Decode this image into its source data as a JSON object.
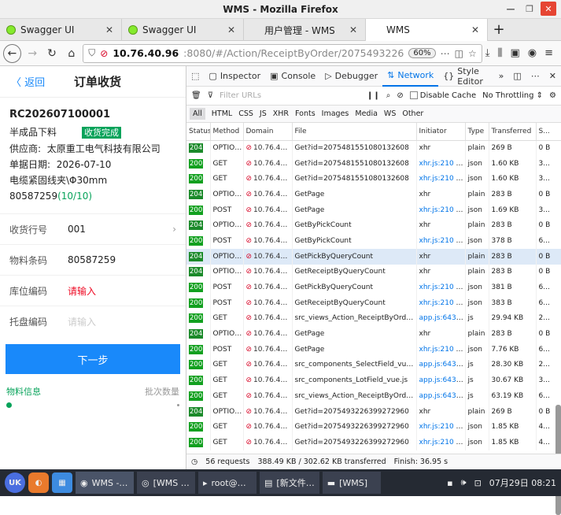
{
  "window": {
    "title": "WMS - Mozilla Firefox"
  },
  "tabs": [
    {
      "label": "Swagger UI",
      "icon": "swagger-icon"
    },
    {
      "label": "Swagger UI",
      "icon": "swagger-icon"
    },
    {
      "label": "用户管理 - WMS",
      "icon": "page-icon"
    },
    {
      "label": "WMS",
      "icon": "page-icon"
    }
  ],
  "url": {
    "host": "10.76.40.96",
    "path": ":8080/#/Action/ReceiptByOrder/2075493226",
    "zoom": "60%"
  },
  "app": {
    "back": "〈 返回",
    "title": "订单收货",
    "order_no": "RC202607100001",
    "type": "半成品下料",
    "status": "收货完成",
    "supplier_label": "供应商:",
    "supplier": "太原重工电气科技有限公司",
    "date_label": "单据日期:",
    "date": "2026-07-10",
    "item_prefix": "电缆紧固线夹\\Φ30mm 80587259",
    "item_count": "(10/10)",
    "fields": {
      "row_label": "收货行号",
      "row_value": "001",
      "material_label": "物料条码",
      "material_value": "80587259",
      "location_label": "库位编码",
      "location_placeholder": "请输入",
      "tray_label": "托盘编码",
      "tray_placeholder": "请输入"
    },
    "next_button": "下一步",
    "info_left": "物料信息",
    "info_right": "批次数量"
  },
  "devtools": {
    "tabs": [
      "Inspector",
      "Console",
      "Debugger",
      "Network",
      "Style Editor"
    ],
    "filter_placeholder": "Filter URLs",
    "disable_cache": "Disable Cache",
    "throttling": "No Throttling ⇕",
    "type_filters": [
      "All",
      "HTML",
      "CSS",
      "JS",
      "XHR",
      "Fonts",
      "Images",
      "Media",
      "WS",
      "Other"
    ],
    "columns": [
      "Status",
      "Method",
      "Domain",
      "File",
      "Initiator",
      "Type",
      "Transferred",
      "S..."
    ],
    "rows": [
      {
        "status": "204",
        "method": "OPTIONS",
        "domain": "10.76.40.9...",
        "file": "Get?id=2075481551080132608",
        "initiator": "xhr",
        "type": "plain",
        "transferred": "269 B",
        "size": "0 B"
      },
      {
        "status": "200",
        "method": "GET",
        "domain": "10.76.40.9...",
        "file": "Get?id=2075481551080132608",
        "initiator": "xhr.js:210 (xhr)",
        "type": "json",
        "transferred": "1.60 KB",
        "size": "3..."
      },
      {
        "status": "200",
        "method": "GET",
        "domain": "10.76.40.9...",
        "file": "Get?id=2075481551080132608",
        "initiator": "xhr.js:210 (xhr)",
        "type": "json",
        "transferred": "1.60 KB",
        "size": "3..."
      },
      {
        "status": "204",
        "method": "OPTIONS",
        "domain": "10.76.40.9...",
        "file": "GetPage",
        "initiator": "xhr",
        "type": "plain",
        "transferred": "283 B",
        "size": "0 B"
      },
      {
        "status": "200",
        "method": "POST",
        "domain": "10.76.40.9...",
        "file": "GetPage",
        "initiator": "xhr.js:210 (xhr)",
        "type": "json",
        "transferred": "1.69 KB",
        "size": "3..."
      },
      {
        "status": "204",
        "method": "OPTIONS",
        "domain": "10.76.40.9...",
        "file": "GetByPickCount",
        "initiator": "xhr",
        "type": "plain",
        "transferred": "283 B",
        "size": "0 B"
      },
      {
        "status": "200",
        "method": "POST",
        "domain": "10.76.40.9...",
        "file": "GetByPickCount",
        "initiator": "xhr.js:210 (xhr)",
        "type": "json",
        "transferred": "378 B",
        "size": "6..."
      },
      {
        "status": "204",
        "method": "OPTIONS",
        "domain": "10.76.40.9...",
        "file": "GetPickByQueryCount",
        "initiator": "xhr",
        "type": "plain",
        "transferred": "283 B",
        "size": "0 B"
      },
      {
        "status": "204",
        "method": "OPTIONS",
        "domain": "10.76.40.9...",
        "file": "GetReceiptByQueryCount",
        "initiator": "xhr",
        "type": "plain",
        "transferred": "283 B",
        "size": "0 B"
      },
      {
        "status": "200",
        "method": "POST",
        "domain": "10.76.40.9...",
        "file": "GetPickByQueryCount",
        "initiator": "xhr.js:210 (xhr)",
        "type": "json",
        "transferred": "381 B",
        "size": "6..."
      },
      {
        "status": "200",
        "method": "POST",
        "domain": "10.76.40.9...",
        "file": "GetReceiptByQueryCount",
        "initiator": "xhr.js:210 (xhr)",
        "type": "json",
        "transferred": "383 B",
        "size": "6..."
      },
      {
        "status": "200",
        "method": "GET",
        "domain": "10.76.40.9...",
        "file": "src_views_Action_ReceiptByOrderList_...",
        "initiator": "app.js:643 (s...",
        "type": "js",
        "transferred": "29.94 KB",
        "size": "2..."
      },
      {
        "status": "204",
        "method": "OPTIONS",
        "domain": "10.76.40.9...",
        "file": "GetPage",
        "initiator": "xhr",
        "type": "plain",
        "transferred": "283 B",
        "size": "0 B"
      },
      {
        "status": "200",
        "method": "POST",
        "domain": "10.76.40.9...",
        "file": "GetPage",
        "initiator": "xhr.js:210 (xhr)",
        "type": "json",
        "transferred": "7.76 KB",
        "size": "6..."
      },
      {
        "status": "200",
        "method": "GET",
        "domain": "10.76.40.9...",
        "file": "src_components_SelectField_vue.js",
        "initiator": "app.js:643 (s...",
        "type": "js",
        "transferred": "28.30 KB",
        "size": "2..."
      },
      {
        "status": "200",
        "method": "GET",
        "domain": "10.76.40.9...",
        "file": "src_components_LotField_vue.js",
        "initiator": "app.js:643 (s...",
        "type": "js",
        "transferred": "30.67 KB",
        "size": "3..."
      },
      {
        "status": "200",
        "method": "GET",
        "domain": "10.76.40.9...",
        "file": "src_views_Action_ReceiptByOrder_vue.js",
        "initiator": "app.js:643 (s...",
        "type": "js",
        "transferred": "63.19 KB",
        "size": "6..."
      },
      {
        "status": "204",
        "method": "OPTIONS",
        "domain": "10.76.40.9...",
        "file": "Get?id=2075493226399272960",
        "initiator": "xhr",
        "type": "plain",
        "transferred": "269 B",
        "size": "0 B"
      },
      {
        "status": "200",
        "method": "GET",
        "domain": "10.76.40.9...",
        "file": "Get?id=2075493226399272960",
        "initiator": "xhr.js:210 (xhr)",
        "type": "json",
        "transferred": "1.85 KB",
        "size": "4..."
      },
      {
        "status": "200",
        "method": "GET",
        "domain": "10.76.40.9...",
        "file": "Get?id=2075493226399272960",
        "initiator": "xhr.js:210 (xhr)",
        "type": "json",
        "transferred": "1.85 KB",
        "size": "4..."
      }
    ],
    "selected_row": 7,
    "status": {
      "requests": "56 requests",
      "transferred": "388.49 KB / 302.62 KB transferred",
      "finish": "Finish: 36.95 s"
    }
  },
  "taskbar": {
    "items": [
      "WMS -…",
      "[WMS …",
      "root@…",
      "[新文件…",
      "[WMS]"
    ],
    "clock": "07月29日 08:21"
  }
}
